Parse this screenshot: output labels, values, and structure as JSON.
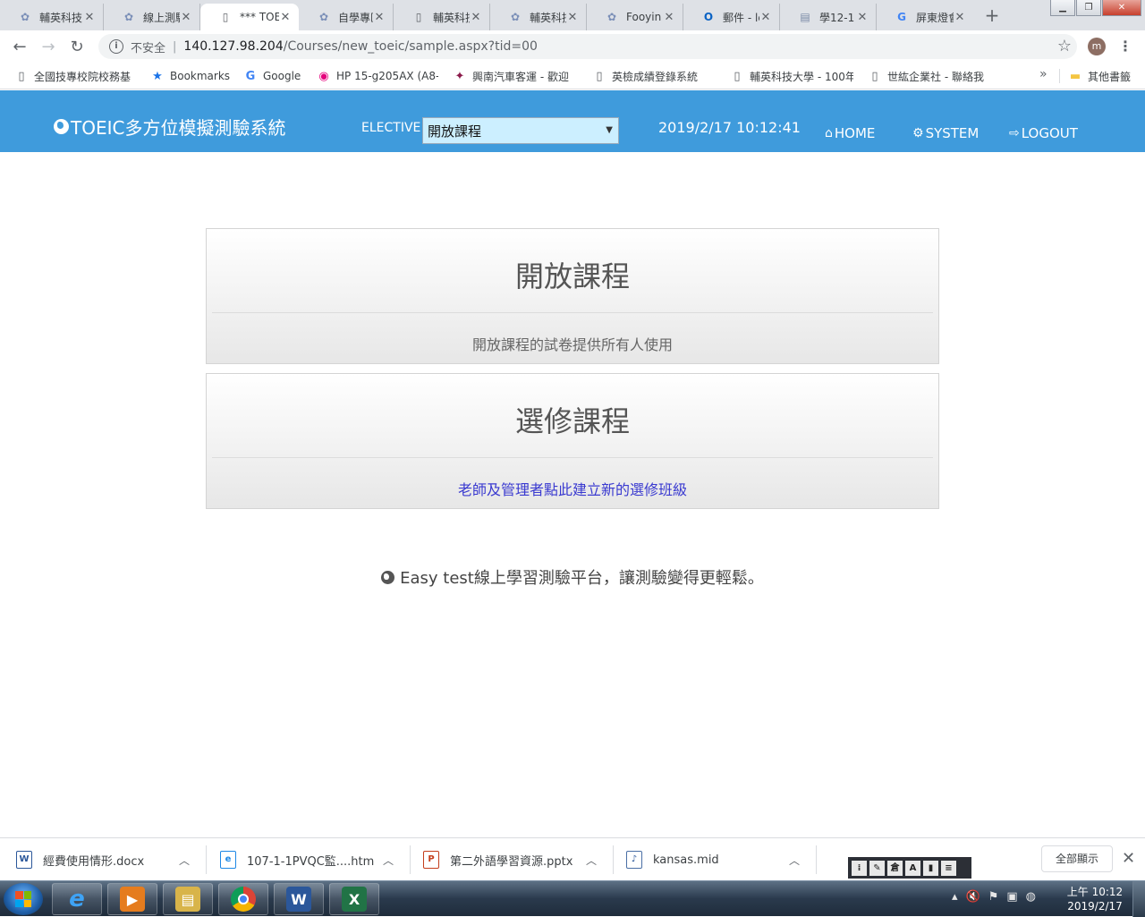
{
  "browser": {
    "tabs": [
      {
        "title": "輔英科技",
        "icon": "circle-logo-icon",
        "active": false
      },
      {
        "title": "線上測驗",
        "icon": "circle-logo-icon",
        "active": false
      },
      {
        "title": "*** TOE",
        "icon": "page-icon",
        "active": true
      },
      {
        "title": "自學專區",
        "icon": "circle-logo-icon",
        "active": false
      },
      {
        "title": "輔英科技",
        "icon": "page-icon",
        "active": false
      },
      {
        "title": "輔英科技",
        "icon": "circle-logo-icon",
        "active": false
      },
      {
        "title": "Fooyin",
        "icon": "circle-logo-icon",
        "active": false
      },
      {
        "title": "郵件 - le",
        "icon": "outlook-icon",
        "active": false
      },
      {
        "title": "學12-1",
        "icon": "doc-icon",
        "active": false
      },
      {
        "title": "屏東燈會",
        "icon": "google-icon",
        "active": false
      }
    ],
    "address": {
      "security_label": "不安全",
      "host": "140.127.98.204",
      "path": "/Courses/new_toeic/sample.aspx?tid=00"
    },
    "profile_initial": "m",
    "bookmarks": [
      {
        "label": "全國技專校院校務基",
        "icon": "page-icon"
      },
      {
        "label": "Bookmarks",
        "icon": "star-icon"
      },
      {
        "label": "Google",
        "icon": "google-icon"
      },
      {
        "label": "HP 15-g205AX (A8-",
        "icon": "hp-icon"
      },
      {
        "label": "興南汽車客運 - 歡迎",
        "icon": "bus-logo-icon"
      },
      {
        "label": "英檢成績登錄系統",
        "icon": "page-icon"
      },
      {
        "label": "輔英科技大學 - 100年",
        "icon": "page-icon"
      },
      {
        "label": "世紘企業社 - 聯絡我",
        "icon": "page-icon"
      }
    ],
    "bookmarks_more": "»",
    "other_bookmarks": "其他書籤"
  },
  "site": {
    "brand": "TOEIC多方位模擬測驗系統",
    "elective_label": "ELECTIVE",
    "elective_selected": "開放課程",
    "datetime": "2019/2/17 10:12:41",
    "nav": {
      "home": "HOME",
      "system": "SYSTEM",
      "logout": "LOGOUT"
    },
    "header_color": "#3f9bdc"
  },
  "panels": [
    {
      "title": "開放課程",
      "description": "開放課程的試卷提供所有人使用",
      "is_link": false
    },
    {
      "title": "選修課程",
      "description": "老師及管理者點此建立新的選修班級",
      "is_link": true
    }
  ],
  "footer_note": "Easy test線上學習測驗平台，讓測驗變得更輕鬆。",
  "downloads": {
    "items": [
      {
        "filename": "經費使用情形.docx",
        "type": "word"
      },
      {
        "filename": "107-1-1PVQC監....htm",
        "type": "htm"
      },
      {
        "filename": "第二外語學習資源.pptx",
        "type": "ppt"
      },
      {
        "filename": "kansas.mid",
        "type": "mid"
      }
    ],
    "show_all": "全部顯示"
  },
  "taskbar": {
    "apps": [
      {
        "name": "internet-explorer",
        "glyph": "e",
        "color": "#1e88e5"
      },
      {
        "name": "media-player",
        "glyph": "▶",
        "color": "#e57c1e"
      },
      {
        "name": "file-explorer",
        "glyph": "▤",
        "color": "#d8b44a"
      },
      {
        "name": "chrome",
        "glyph": "◉",
        "color": "#db4437"
      },
      {
        "name": "word",
        "glyph": "W",
        "color": "#2b579a"
      },
      {
        "name": "excel",
        "glyph": "X",
        "color": "#217346"
      }
    ],
    "clock_time": "上午 10:12",
    "clock_date": "2019/2/17"
  }
}
